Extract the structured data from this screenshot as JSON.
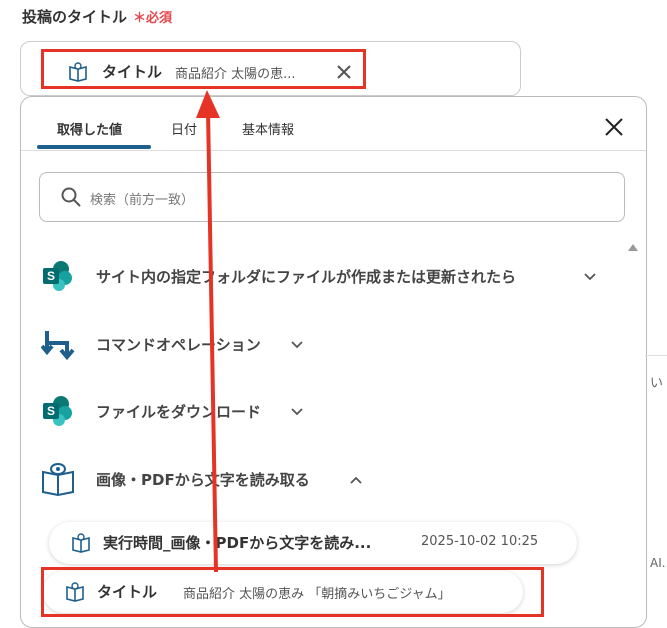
{
  "field": {
    "label": "投稿のタイトル",
    "required_mark": "＊必須"
  },
  "selected_chip": {
    "label": "タイトル",
    "value": "商品紹介 太陽の恵..."
  },
  "tabs": [
    {
      "label": "取得した値",
      "active": true
    },
    {
      "label": "日付"
    },
    {
      "label": "基本情報"
    }
  ],
  "search": {
    "placeholder": "検索（前方一致）"
  },
  "sections": [
    {
      "label": "サイト内の指定フォルダにファイルが作成または更新されたら",
      "icon": "sharepoint-icon",
      "expanded": false
    },
    {
      "label": "コマンドオペレーション",
      "icon": "command-operation-icon",
      "expanded": false
    },
    {
      "label": "ファイルをダウンロード",
      "icon": "sharepoint-icon",
      "expanded": false
    },
    {
      "label": "画像・PDFから文字を読み取る",
      "icon": "ocr-book-icon",
      "expanded": true
    }
  ],
  "items": [
    {
      "label": "実行時間_画像・PDFから文字を読み...",
      "value": "2025-10-02 10:25"
    },
    {
      "label": "タイトル",
      "value": "商品紹介 太陽の恵み 「朝摘みいちごジャム」"
    }
  ],
  "right_edge": {
    "text1": "い",
    "text2": "AI..."
  },
  "colors": {
    "accent": "#1e5f8c",
    "highlight": "#e53426",
    "required": "#e5484d",
    "sharepoint": "#0b7a75"
  }
}
